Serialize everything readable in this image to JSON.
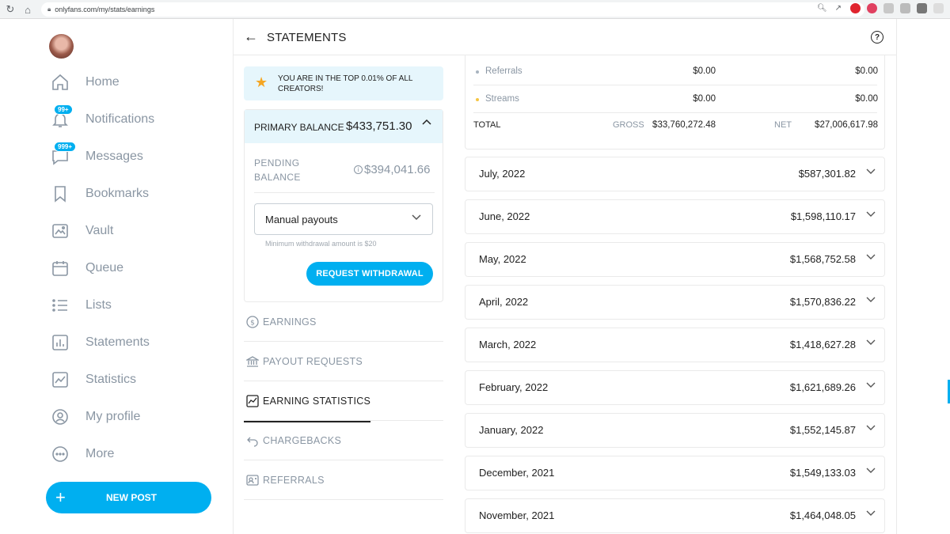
{
  "browser": {
    "url": "onlyfans.com/my/stats/earnings"
  },
  "sidebar": {
    "items": [
      {
        "label": "Home",
        "icon": "home-icon"
      },
      {
        "label": "Notifications",
        "icon": "bell-icon",
        "badge": "99+"
      },
      {
        "label": "Messages",
        "icon": "message-icon",
        "badge": "999+"
      },
      {
        "label": "Bookmarks",
        "icon": "bookmark-icon"
      },
      {
        "label": "Vault",
        "icon": "vault-icon"
      },
      {
        "label": "Queue",
        "icon": "calendar-icon"
      },
      {
        "label": "Lists",
        "icon": "list-icon"
      },
      {
        "label": "Statements",
        "icon": "statements-icon"
      },
      {
        "label": "Statistics",
        "icon": "statistics-icon"
      },
      {
        "label": "My profile",
        "icon": "profile-icon"
      },
      {
        "label": "More",
        "icon": "more-icon"
      }
    ],
    "new_post_label": "NEW POST"
  },
  "header": {
    "title": "STATEMENTS"
  },
  "banner": {
    "text": "YOU ARE IN THE TOP 0.01% OF ALL CREATORS!"
  },
  "balance": {
    "primary_label": "PRIMARY BALANCE",
    "primary_amount": "$433,751.30",
    "pending_label": "PENDING BALANCE",
    "pending_amount": "$394,041.66",
    "payout_select_value": "Manual payouts",
    "min_note": "Minimum withdrawal amount is $20",
    "withdraw_label": "REQUEST WITHDRAWAL"
  },
  "menu": [
    {
      "label": "EARNINGS",
      "icon": "dollar-icon"
    },
    {
      "label": "PAYOUT REQUESTS",
      "icon": "bank-icon"
    },
    {
      "label": "EARNING STATISTICS",
      "icon": "chart-icon"
    },
    {
      "label": "CHARGEBACKS",
      "icon": "undo-icon"
    },
    {
      "label": "REFERRALS",
      "icon": "referral-icon"
    }
  ],
  "summary": {
    "rows": [
      {
        "name": "Referrals",
        "gross": "$0.00",
        "net": "$0.00",
        "dot_color": "#a8b4bf"
      },
      {
        "name": "Streams",
        "gross": "$0.00",
        "net": "$0.00",
        "dot_color": "#f5c542"
      }
    ],
    "total_label": "TOTAL",
    "gross_label": "GROSS",
    "gross_value": "$33,760,272.48",
    "net_label": "NET",
    "net_value": "$27,006,617.98"
  },
  "months": [
    {
      "name": "July, 2022",
      "amount": "$587,301.82"
    },
    {
      "name": "June, 2022",
      "amount": "$1,598,110.17"
    },
    {
      "name": "May, 2022",
      "amount": "$1,568,752.58"
    },
    {
      "name": "April, 2022",
      "amount": "$1,570,836.22"
    },
    {
      "name": "March, 2022",
      "amount": "$1,418,627.28"
    },
    {
      "name": "February, 2022",
      "amount": "$1,621,689.26"
    },
    {
      "name": "January, 2022",
      "amount": "$1,552,145.87"
    },
    {
      "name": "December, 2021",
      "amount": "$1,549,133.03"
    },
    {
      "name": "November, 2021",
      "amount": "$1,464,048.05"
    }
  ],
  "colors": {
    "accent": "#00aff0",
    "muted": "#8a96a3",
    "highlight_bg": "#e6f6fc"
  }
}
